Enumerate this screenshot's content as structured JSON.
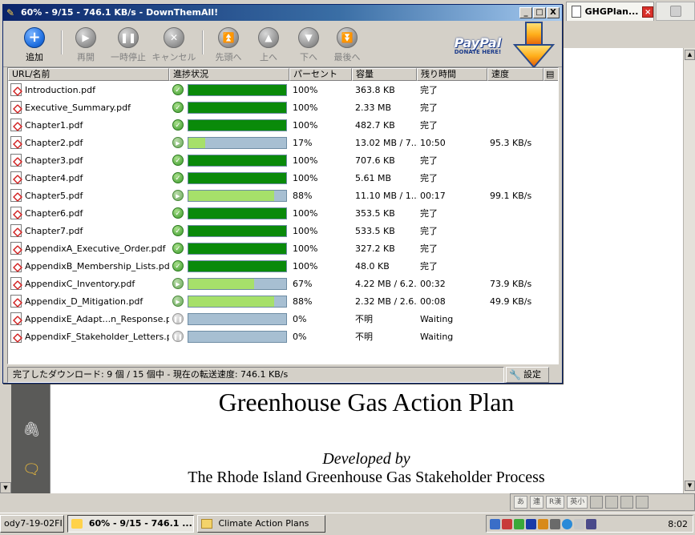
{
  "window": {
    "title": "60% - 9/15 - 746.1 KB/s - DownThemAll!",
    "minimize": "_",
    "maximize": "□",
    "close": "X"
  },
  "toolbar": {
    "add": "追加",
    "resume": "再開",
    "pause": "一時停止",
    "cancel": "キャンセル",
    "top": "先頭へ",
    "up": "上へ",
    "down": "下へ",
    "bottom": "最後へ"
  },
  "paypal": {
    "logo": "PayPal",
    "donate": "DONATE HERE!"
  },
  "columns": {
    "url": "URL/名前",
    "progress": "進捗状況",
    "percent": "パーセント",
    "size": "容量",
    "remaining": "残り時間",
    "speed": "速度"
  },
  "downloads": [
    {
      "name": "Introduction.pdf",
      "status": "done",
      "progress": 1.0,
      "percent": "100%",
      "size": "363.8 KB",
      "remaining": "完了",
      "speed": ""
    },
    {
      "name": "Executive_Summary.pdf",
      "status": "done",
      "progress": 1.0,
      "percent": "100%",
      "size": "2.33 MB",
      "remaining": "完了",
      "speed": ""
    },
    {
      "name": "Chapter1.pdf",
      "status": "done",
      "progress": 1.0,
      "percent": "100%",
      "size": "482.7 KB",
      "remaining": "完了",
      "speed": ""
    },
    {
      "name": "Chapter2.pdf",
      "status": "running",
      "progress": 0.17,
      "percent": "17%",
      "size": "13.02 MB / 7...",
      "remaining": "10:50",
      "speed": "95.3 KB/s"
    },
    {
      "name": "Chapter3.pdf",
      "status": "done",
      "progress": 1.0,
      "percent": "100%",
      "size": "707.6 KB",
      "remaining": "完了",
      "speed": ""
    },
    {
      "name": "Chapter4.pdf",
      "status": "done",
      "progress": 1.0,
      "percent": "100%",
      "size": "5.61 MB",
      "remaining": "完了",
      "speed": ""
    },
    {
      "name": "Chapter5.pdf",
      "status": "running",
      "progress": 0.88,
      "percent": "88%",
      "size": "11.10 MB / 1...",
      "remaining": "00:17",
      "speed": "99.1 KB/s"
    },
    {
      "name": "Chapter6.pdf",
      "status": "done",
      "progress": 1.0,
      "percent": "100%",
      "size": "353.5 KB",
      "remaining": "完了",
      "speed": ""
    },
    {
      "name": "Chapter7.pdf",
      "status": "done",
      "progress": 1.0,
      "percent": "100%",
      "size": "533.5 KB",
      "remaining": "完了",
      "speed": ""
    },
    {
      "name": "AppendixA_Executive_Order.pdf",
      "status": "done",
      "progress": 1.0,
      "percent": "100%",
      "size": "327.2 KB",
      "remaining": "完了",
      "speed": ""
    },
    {
      "name": "AppendixB_Membership_Lists.pdf",
      "status": "done",
      "progress": 1.0,
      "percent": "100%",
      "size": "48.0 KB",
      "remaining": "完了",
      "speed": ""
    },
    {
      "name": "AppendixC_Inventory.pdf",
      "status": "running",
      "progress": 0.67,
      "percent": "67%",
      "size": "4.22 MB / 6.2...",
      "remaining": "00:32",
      "speed": "73.9 KB/s"
    },
    {
      "name": "Appendix_D_Mitigation.pdf",
      "status": "running",
      "progress": 0.88,
      "percent": "88%",
      "size": "2.32 MB / 2.6...",
      "remaining": "00:08",
      "speed": "49.9 KB/s"
    },
    {
      "name": "AppendixE_Adapt...n_Response.pdf",
      "status": "waiting",
      "progress": 0.0,
      "percent": "0%",
      "size": "不明",
      "remaining": "Waiting",
      "speed": ""
    },
    {
      "name": "AppendixF_Stakeholder_Letters.pdf",
      "status": "waiting",
      "progress": 0.0,
      "percent": "0%",
      "size": "不明",
      "remaining": "Waiting",
      "speed": ""
    }
  ],
  "statusbar": {
    "text": "完了したダウンロード: 9 個 / 15 個中 - 現在の転送速度: 746.1 KB/s",
    "settings": "設定"
  },
  "browser": {
    "tab_title": "GHGPlan..."
  },
  "pdf": {
    "title": "Greenhouse Gas Action Plan",
    "developed_by": "Developed by",
    "org": "The Rhode Island Greenhouse Gas Stakeholder Process"
  },
  "ime": {
    "items": [
      "あ",
      "連",
      "R漢",
      "英小"
    ]
  },
  "taskbar": {
    "items": [
      {
        "label": "ody7-19-02FI...",
        "active": false
      },
      {
        "label": "60% - 9/15 - 746.1 ...",
        "active": true
      },
      {
        "label": "Climate Action Plans",
        "active": false
      }
    ],
    "clock": "8:02"
  },
  "colors": {
    "progress_done": "#0a8a0a",
    "progress_partial": "#a6e06a",
    "progress_track": "#a7bfd2",
    "titlebar": "#0a246a"
  }
}
